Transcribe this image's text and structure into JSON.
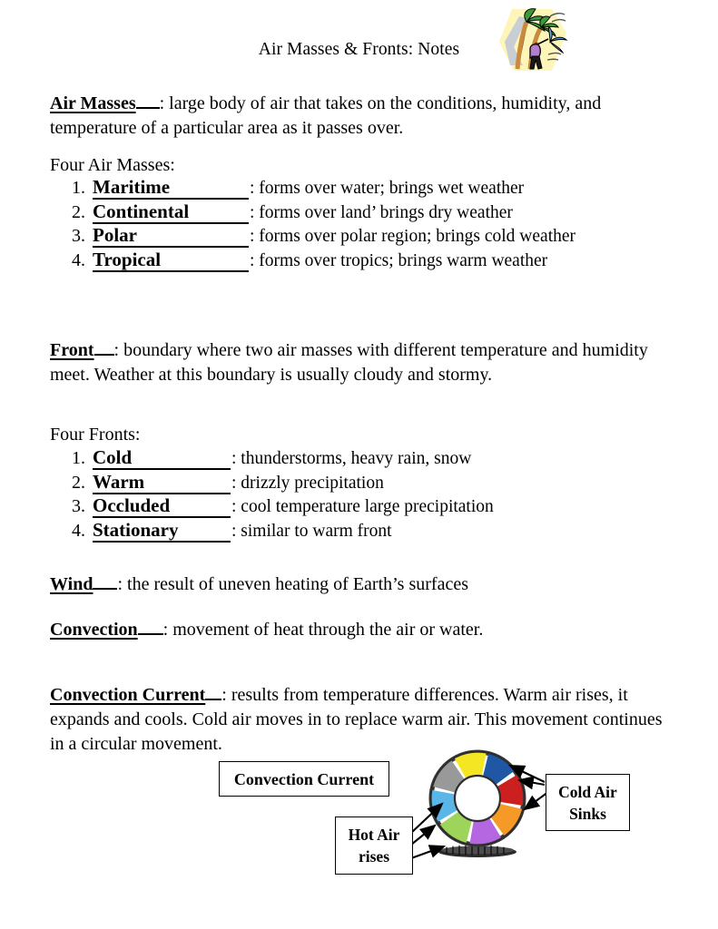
{
  "document": {
    "title": "Air Masses & Fronts: Notes",
    "clipart_name": "windy-weather-clipart"
  },
  "sections": {
    "air_masses": {
      "term": "Air Masses",
      "definition": ": large body of air that takes on the conditions, humidity, and temperature of a particular area as it passes over.",
      "list_heading": "Four Air Masses:",
      "items": [
        {
          "num": "1.",
          "key": "Maritime",
          "desc": ": forms over water; brings wet weather"
        },
        {
          "num": "2.",
          "key": "Continental",
          "desc": ": forms over land’ brings dry weather"
        },
        {
          "num": "3.",
          "key": "Polar",
          "desc": ": forms over polar region; brings cold weather"
        },
        {
          "num": "4.",
          "key": "Tropical",
          "desc": ": forms over tropics; brings warm weather"
        }
      ]
    },
    "front": {
      "term": "Front",
      "definition": ": boundary where two air masses with different temperature and humidity meet.  Weather at this boundary is usually cloudy and stormy.",
      "list_heading": "Four Fronts:",
      "items": [
        {
          "num": "1.",
          "key": "Cold",
          "desc": ": thunderstorms, heavy rain, snow"
        },
        {
          "num": "2.",
          "key": "Warm",
          "desc": ": drizzly precipitation"
        },
        {
          "num": "3.",
          "key": "Occluded",
          "desc": ": cool temperature large precipitation"
        },
        {
          "num": "4.",
          "key": "Stationary",
          "desc": ": similar to warm front"
        }
      ]
    },
    "wind": {
      "term": "Wind",
      "definition": ": the result of uneven heating of Earth’s surfaces"
    },
    "convection": {
      "term": "Convection",
      "definition": ": movement of heat through the air or water."
    },
    "convection_current": {
      "term": "Convection Current",
      "definition": ": results from temperature differences.  Warm air rises, it expands and cools.  Cold air moves in to replace warm air.  This movement continues in a circular movement."
    }
  },
  "diagram": {
    "name": "convection-current-diagram",
    "boxes": {
      "convection_current": "Convection Current",
      "cold_air_line1": "Cold Air",
      "cold_air_line2": "Sinks",
      "hot_air_line1": "Hot Air",
      "hot_air_line2": "rises"
    },
    "ring_segments": [
      {
        "label": "top-left-segment",
        "color": "#1f57a4"
      },
      {
        "label": "top-right-segment",
        "color": "#cc1f1f"
      },
      {
        "label": "right-upper-segment",
        "color": "#f59a26"
      },
      {
        "label": "right-lower-segment",
        "color": "#b467e0"
      },
      {
        "label": "bottom-right-segment",
        "color": "#9ed45a"
      },
      {
        "label": "bottom-left-segment",
        "color": "#5bb6e8"
      },
      {
        "label": "left-lower-segment",
        "color": "#999999"
      },
      {
        "label": "left-upper-segment",
        "color": "#f5e624"
      }
    ],
    "arrow_color": "#000000"
  }
}
